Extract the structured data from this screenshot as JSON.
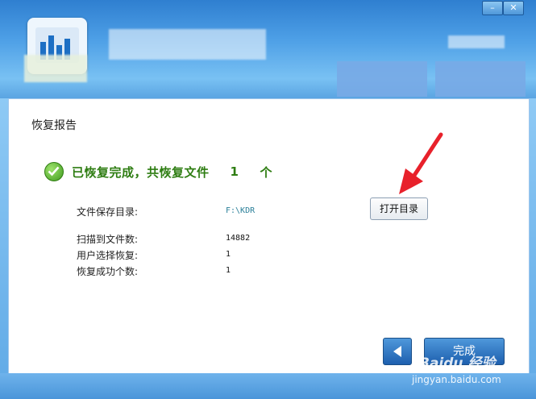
{
  "window": {
    "minimize_glyph": "–",
    "close_glyph": "✕"
  },
  "panel": {
    "title": "恢复报告",
    "status": {
      "message": "已恢复完成，共恢复文件",
      "count": "1",
      "unit": "个",
      "icon": "check-circle-icon"
    },
    "fields": [
      {
        "label": "文件保存目录:",
        "value": "F:\\KDR"
      },
      {
        "label": "扫描到文件数:",
        "value": "14882"
      },
      {
        "label": "用户选择恢复:",
        "value": "1"
      },
      {
        "label": "恢复成功个数:",
        "value": "1"
      }
    ],
    "open_dir_button": "打开目录"
  },
  "footer": {
    "back_icon": "left-arrow-icon",
    "finish_button": "完成"
  },
  "watermark": {
    "name": "Baidu 经验",
    "url": "jingyan.baidu.com"
  },
  "colors": {
    "status_green": "#2e7d12",
    "path_blue": "#2a7f99",
    "annotation_red": "#e8212b"
  }
}
